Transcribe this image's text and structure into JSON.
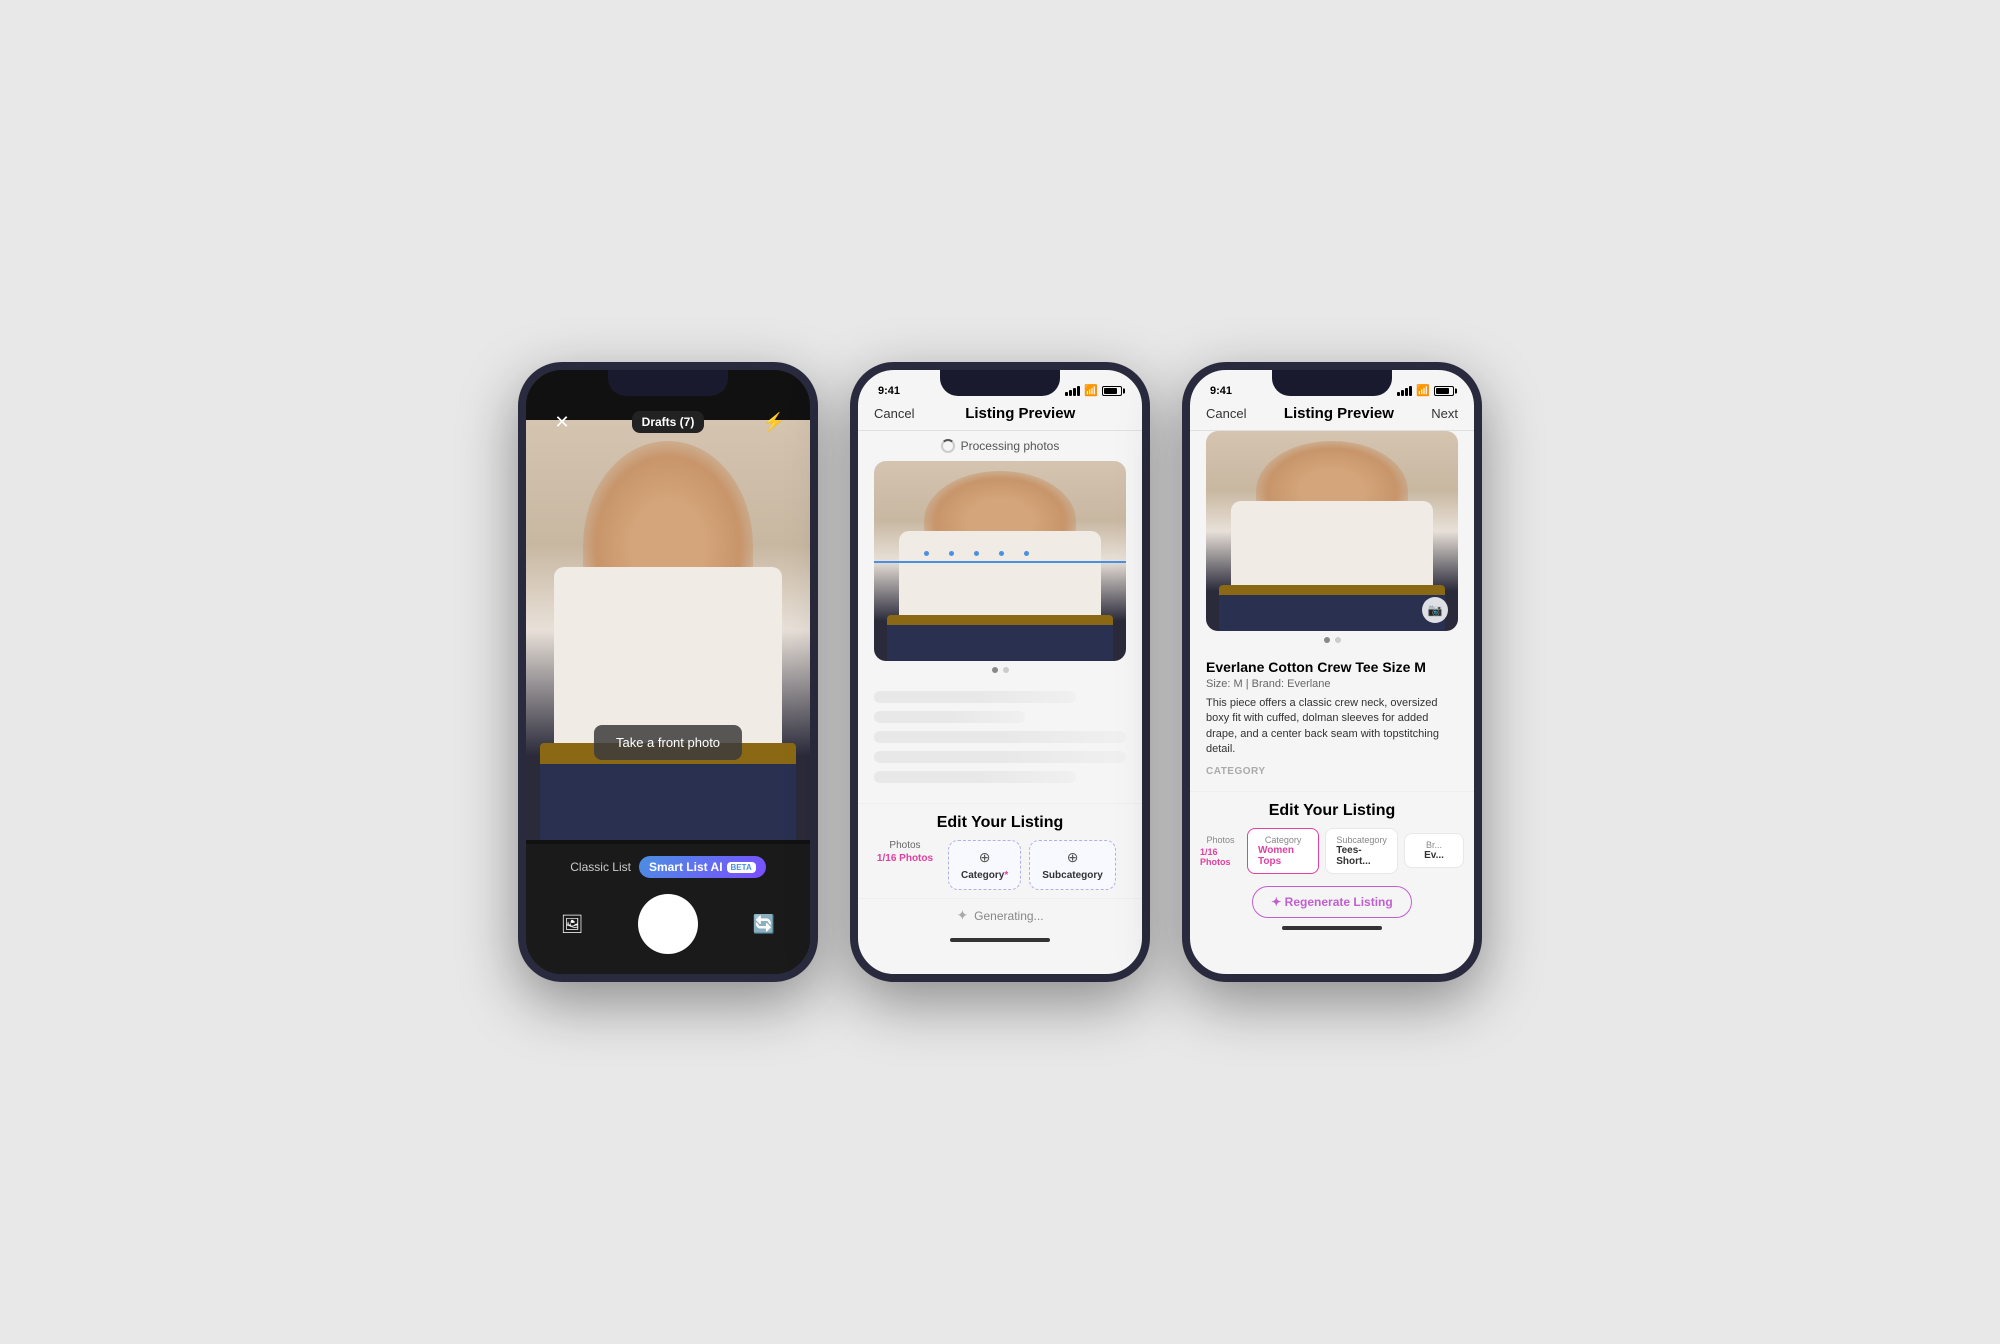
{
  "phones": {
    "phone1": {
      "drafts_label": "Drafts (7)",
      "photo_prompt": "Take a front photo",
      "mode_classic": "Classic List",
      "mode_smart": "Smart List AI",
      "beta": "BETA"
    },
    "phone2": {
      "time": "9:41",
      "title": "Listing Preview",
      "cancel": "Cancel",
      "processing": "Processing photos",
      "edit_title": "Edit Your Listing",
      "photos_label": "Photos",
      "photos_value": "1/16 Photos",
      "category_label": "Category",
      "category_required": "*",
      "subcategory_label": "Subcategory",
      "generating": "Generating..."
    },
    "phone3": {
      "time": "9:41",
      "title": "Listing Preview",
      "cancel": "Cancel",
      "next": "Next",
      "listing_title": "Everlane Cotton Crew Tee Size M",
      "listing_meta": "Size: M  |  Brand: Everlane",
      "listing_desc": "This piece offers a classic crew neck, oversized boxy fit with cuffed, dolman sleeves for added drape, and a center back seam with topstitching detail.",
      "category_header": "CATEGORY",
      "edit_title": "Edit Your Listing",
      "photos_label": "Photos",
      "photos_value": "1/16 Photos",
      "category_tab_label": "Category",
      "category_tab_value": "Women Tops",
      "subcategory_tab_label": "Subcategory",
      "subcategory_tab_value": "Tees- Short...",
      "brand_tab_label": "Br...",
      "brand_tab_value": "Ev...",
      "regenerate": "✦ Regenerate Listing"
    }
  }
}
